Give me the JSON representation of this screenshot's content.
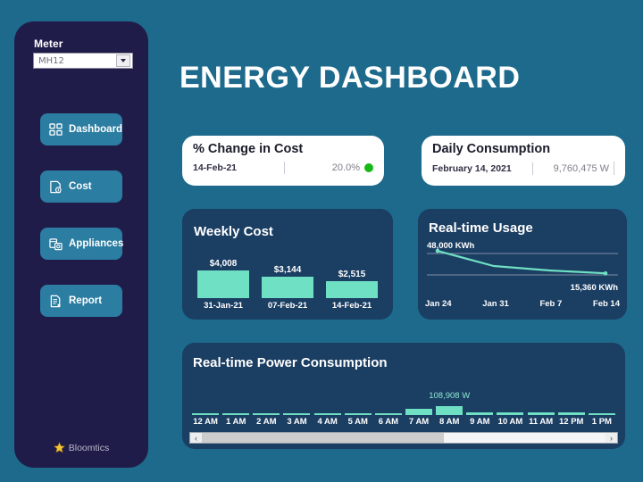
{
  "sidebar": {
    "meter": {
      "label": "Meter",
      "value": "MH12",
      "placeholder": "MH12"
    },
    "nav": [
      {
        "label": "Dashboard",
        "icon": "grid-icon"
      },
      {
        "label": "Cost",
        "icon": "cost-document-icon"
      },
      {
        "label": "Appliances",
        "icon": "appliances-icon"
      },
      {
        "label": "Report",
        "icon": "report-document-icon"
      }
    ],
    "brand": {
      "name": "Bloomtics",
      "icon": "star-icon"
    }
  },
  "header": {
    "title": "ENERGY DASHBOARD"
  },
  "kpi_cards": [
    {
      "title": "% Change in Cost",
      "date": "14-Feb-21",
      "value": "20.0%",
      "status_color": "#16b816"
    },
    {
      "title": "Daily Consumption",
      "date": "February 14, 2021",
      "value": "9,760,475 W"
    }
  ],
  "panels": {
    "weekly_cost": {
      "title": "Weekly Cost"
    },
    "realtime_usage": {
      "title": "Real-time Usage"
    },
    "realtime_power": {
      "title": "Real-time Power Consumption"
    }
  },
  "scrollbar": {
    "left_arrow": "‹",
    "right_arrow": "›",
    "thumb_percent": 60
  },
  "colors": {
    "background": "#1d6a8c",
    "sidebar": "#201c49",
    "panel": "#1b3e63",
    "accent_mint": "#6fe0c3",
    "nav_button": "#2b7da1",
    "status_green": "#16b816",
    "brand_star": "#f4c23a"
  },
  "chart_data": [
    {
      "type": "bar",
      "title": "Weekly Cost",
      "categories": [
        "31-Jan-21",
        "07-Feb-21",
        "14-Feb-21"
      ],
      "values": [
        4008,
        3144,
        2515
      ],
      "value_labels": [
        "$4,008",
        "$3,144",
        "$2,515"
      ],
      "xlabel": "",
      "ylabel": "",
      "ylim": [
        0,
        4400
      ],
      "grid": false,
      "legend": "none"
    },
    {
      "type": "line",
      "title": "Real-time Usage",
      "x": [
        "Jan 24",
        "Jan 31",
        "Feb 7",
        "Feb 14"
      ],
      "values": [
        48000,
        26000,
        19500,
        15360
      ],
      "point_labels": {
        "first": "48,000 KWh",
        "last": "15,360 KWh"
      },
      "xlabel": "",
      "ylabel": "KWh",
      "ylim": [
        0,
        52000
      ],
      "grid": true,
      "gridlines": 2,
      "legend": "none"
    },
    {
      "type": "bar",
      "title": "Real-time Power Consumption",
      "categories": [
        "12 AM",
        "1 AM",
        "2 AM",
        "3 AM",
        "4 AM",
        "5 AM",
        "6 AM",
        "7 AM",
        "8 AM",
        "9 AM",
        "10 AM",
        "11 AM",
        "12 PM",
        "1 PM"
      ],
      "values": [
        8000,
        8000,
        8000,
        9000,
        10000,
        12000,
        13000,
        74000,
        108908,
        30000,
        30000,
        32000,
        28000,
        14000
      ],
      "highlight": {
        "category": "8 AM",
        "label": "108,908 W"
      },
      "xlabel": "",
      "ylabel": "W",
      "ylim": [
        0,
        115000
      ],
      "grid": false,
      "legend": "none"
    }
  ]
}
